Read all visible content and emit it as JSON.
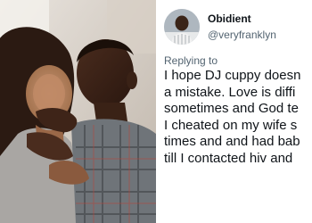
{
  "tweet": {
    "display_name": "Obidient",
    "handle": "@veryfranklyn",
    "replying_label": "Replying to",
    "body_lines": [
      "I hope DJ cuppy doesn",
      "a mistake. Love is diffi",
      "sometimes and God te",
      "I cheated on my wife s",
      "times and and had bab",
      "till I contacted hiv and"
    ]
  },
  "photo": {
    "description_icon": "couple-photo"
  },
  "colors": {
    "text_primary": "#0f1419",
    "text_secondary": "#536471",
    "background": "#ffffff"
  }
}
